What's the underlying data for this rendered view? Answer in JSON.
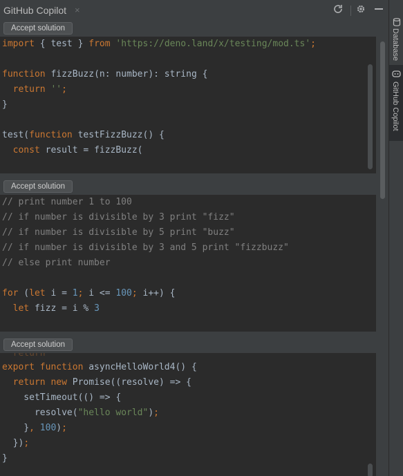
{
  "window": {
    "title": "GitHub Copilot",
    "close_glyph": "×",
    "toolbar_icons": [
      "refresh-icon",
      "gear-icon",
      "minimize-icon"
    ]
  },
  "sidebar": {
    "tabs": [
      {
        "label": "Database",
        "icon": "database-icon",
        "active": false
      },
      {
        "label": "GitHub Copilot",
        "icon": "copilot-icon",
        "active": true
      }
    ]
  },
  "solutions": [
    {
      "accept_label": "Accept solution",
      "lines": [
        [
          [
            "kw",
            "import"
          ],
          [
            "pl",
            " { test } "
          ],
          [
            "kw",
            "from"
          ],
          [
            "pl",
            " "
          ],
          [
            "str",
            "'https://deno.land/x/testing/mod.ts'"
          ],
          [
            "kw",
            ";"
          ]
        ],
        [],
        [
          [
            "kw",
            "function"
          ],
          [
            "pl",
            " fizzBuzz(n: number): string {"
          ]
        ],
        [
          [
            "pl",
            "  "
          ],
          [
            "kw",
            "return"
          ],
          [
            "pl",
            " "
          ],
          [
            "str",
            "''"
          ],
          [
            "kw",
            ";"
          ]
        ],
        [
          [
            "pl",
            "}"
          ]
        ],
        [],
        [
          [
            "pl",
            "test("
          ],
          [
            "kw",
            "function"
          ],
          [
            "pl",
            " testFizzBuzz() {"
          ]
        ],
        [
          [
            "pl",
            "  "
          ],
          [
            "kw",
            "const"
          ],
          [
            "pl",
            " result = fizzBuzz("
          ]
        ]
      ]
    },
    {
      "accept_label": "Accept solution",
      "lines": [
        [
          [
            "com",
            "// print number 1 to 100"
          ]
        ],
        [
          [
            "com",
            "// if number is divisible by 3 print \"fizz\""
          ]
        ],
        [
          [
            "com",
            "// if number is divisible by 5 print \"buzz\""
          ]
        ],
        [
          [
            "com",
            "// if number is divisible by 3 and 5 print \"fizzbuzz\""
          ]
        ],
        [
          [
            "com",
            "// else print number"
          ]
        ],
        [],
        [
          [
            "kw",
            "for"
          ],
          [
            "pl",
            " ("
          ],
          [
            "kw",
            "let"
          ],
          [
            "pl",
            " i = "
          ],
          [
            "num",
            "1"
          ],
          [
            "kw",
            ";"
          ],
          [
            "pl",
            " i <= "
          ],
          [
            "num",
            "100"
          ],
          [
            "kw",
            ";"
          ],
          [
            "pl",
            " i++) {"
          ]
        ],
        [
          [
            "pl",
            "  "
          ],
          [
            "kw",
            "let"
          ],
          [
            "pl",
            " fizz = i % "
          ],
          [
            "num",
            "3"
          ]
        ]
      ]
    },
    {
      "accept_label": "Accept solution",
      "lines": [
        [
          [
            "kw",
            "  return"
          ]
        ],
        [
          [
            "kw",
            "export function"
          ],
          [
            "pl",
            " asyncHelloWorld4() {"
          ]
        ],
        [
          [
            "pl",
            "  "
          ],
          [
            "kw",
            "return new"
          ],
          [
            "pl",
            " Promise((resolve) => {"
          ]
        ],
        [
          [
            "pl",
            "    setTimeout(() => {"
          ]
        ],
        [
          [
            "pl",
            "      resolve("
          ],
          [
            "str",
            "\"hello world\""
          ],
          [
            "pl",
            ")"
          ],
          [
            "kw",
            ";"
          ]
        ],
        [
          [
            "pl",
            "    }"
          ],
          [
            "kw",
            ", "
          ],
          [
            "num",
            "100"
          ],
          [
            "pl",
            ")"
          ],
          [
            "kw",
            ";"
          ]
        ],
        [
          [
            "pl",
            "  })"
          ],
          [
            "kw",
            ";"
          ]
        ],
        [
          [
            "pl",
            "}"
          ]
        ]
      ]
    }
  ]
}
